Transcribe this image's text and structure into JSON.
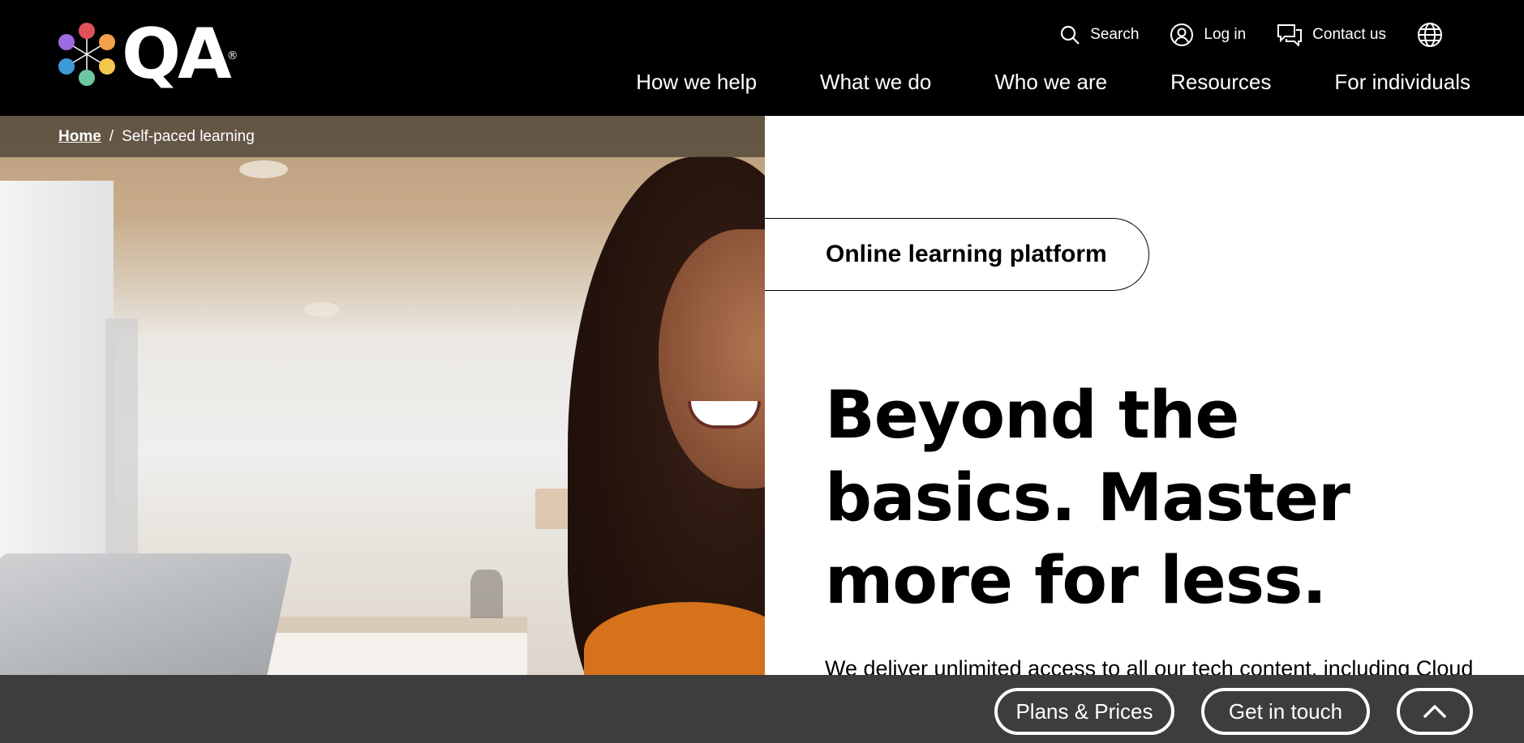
{
  "header": {
    "logo": {
      "text": "QA",
      "registered": "®"
    },
    "utility": {
      "search_label": "Search",
      "login_label": "Log in",
      "contact_label": "Contact us",
      "globe_icon": "globe-icon"
    },
    "nav": [
      {
        "label": "How we help"
      },
      {
        "label": "What we do"
      },
      {
        "label": "Who we are"
      },
      {
        "label": "Resources"
      },
      {
        "label": "For individuals"
      }
    ]
  },
  "breadcrumb": {
    "home": "Home",
    "separator": "/",
    "current": "Self-paced learning"
  },
  "hero": {
    "tag": "Online learning platform",
    "headline": "Beyond the basics. Master more for less.",
    "intro": "We deliver unlimited access to all our tech content, including Cloud"
  },
  "bottom_bar": {
    "plans_label": "Plans & Prices",
    "touch_label": "Get in touch",
    "top_icon": "chevron-up-icon"
  },
  "colors": {
    "header_bg": "#000000",
    "bottom_bar_bg": "#3d3d3d",
    "logo_dots": [
      "#e0525a",
      "#f5a04a",
      "#f4c84d",
      "#6fc7a2",
      "#3e9ad6",
      "#9b6be0"
    ]
  }
}
